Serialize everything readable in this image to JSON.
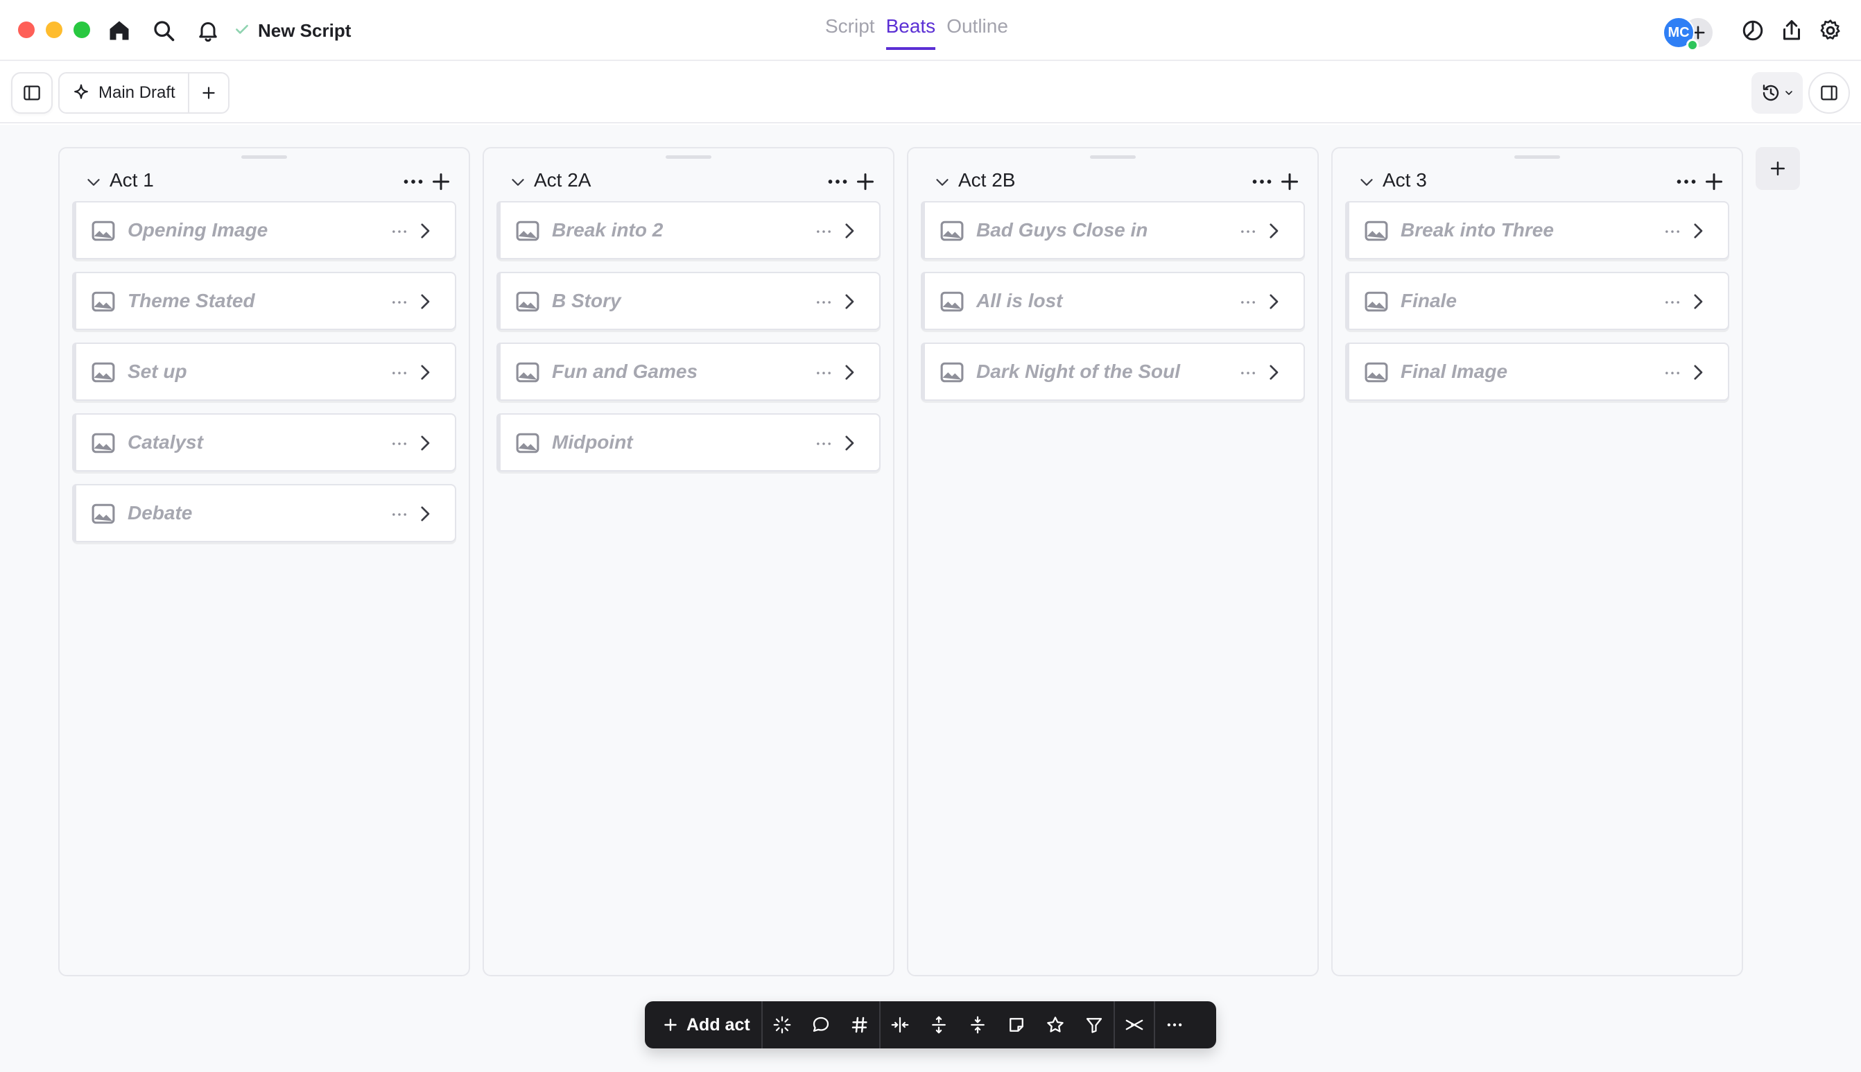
{
  "window": {
    "title": "New Script",
    "saved_status": "saved"
  },
  "mode_tabs": [
    {
      "label": "Script",
      "active": false
    },
    {
      "label": "Beats",
      "active": true
    },
    {
      "label": "Outline",
      "active": false
    }
  ],
  "user": {
    "initials": "MC",
    "status": "online"
  },
  "toolbar": {
    "draft_label": "Main Draft"
  },
  "acts": [
    {
      "title": "Act 1",
      "beats": [
        "Opening Image",
        "Theme Stated",
        "Set up",
        "Catalyst",
        "Debate"
      ]
    },
    {
      "title": "Act 2A",
      "beats": [
        "Break into 2",
        "B Story",
        "Fun and Games",
        "Midpoint"
      ]
    },
    {
      "title": "Act 2B",
      "beats": [
        "Bad Guys Close in",
        "All is lost",
        "Dark Night of the Soul"
      ]
    },
    {
      "title": "Act 3",
      "beats": [
        "Break into Three",
        "Finale",
        "Final Image"
      ]
    }
  ],
  "bottom_toolbar": {
    "add_act_label": "Add act",
    "tools": [
      "sparkle-icon",
      "comment-icon",
      "hashtag-icon",
      "collapse-horizontal-icon",
      "expand-vertical-icon",
      "collapse-vertical-icon",
      "note-icon",
      "star-icon",
      "filter-icon",
      "scissors-icon",
      "more-icon"
    ]
  },
  "colors": {
    "accent": "#5b2fd4",
    "avatar": "#2f7ff5",
    "online": "#2ec55b",
    "toolbar_bg": "#1d1d20"
  }
}
